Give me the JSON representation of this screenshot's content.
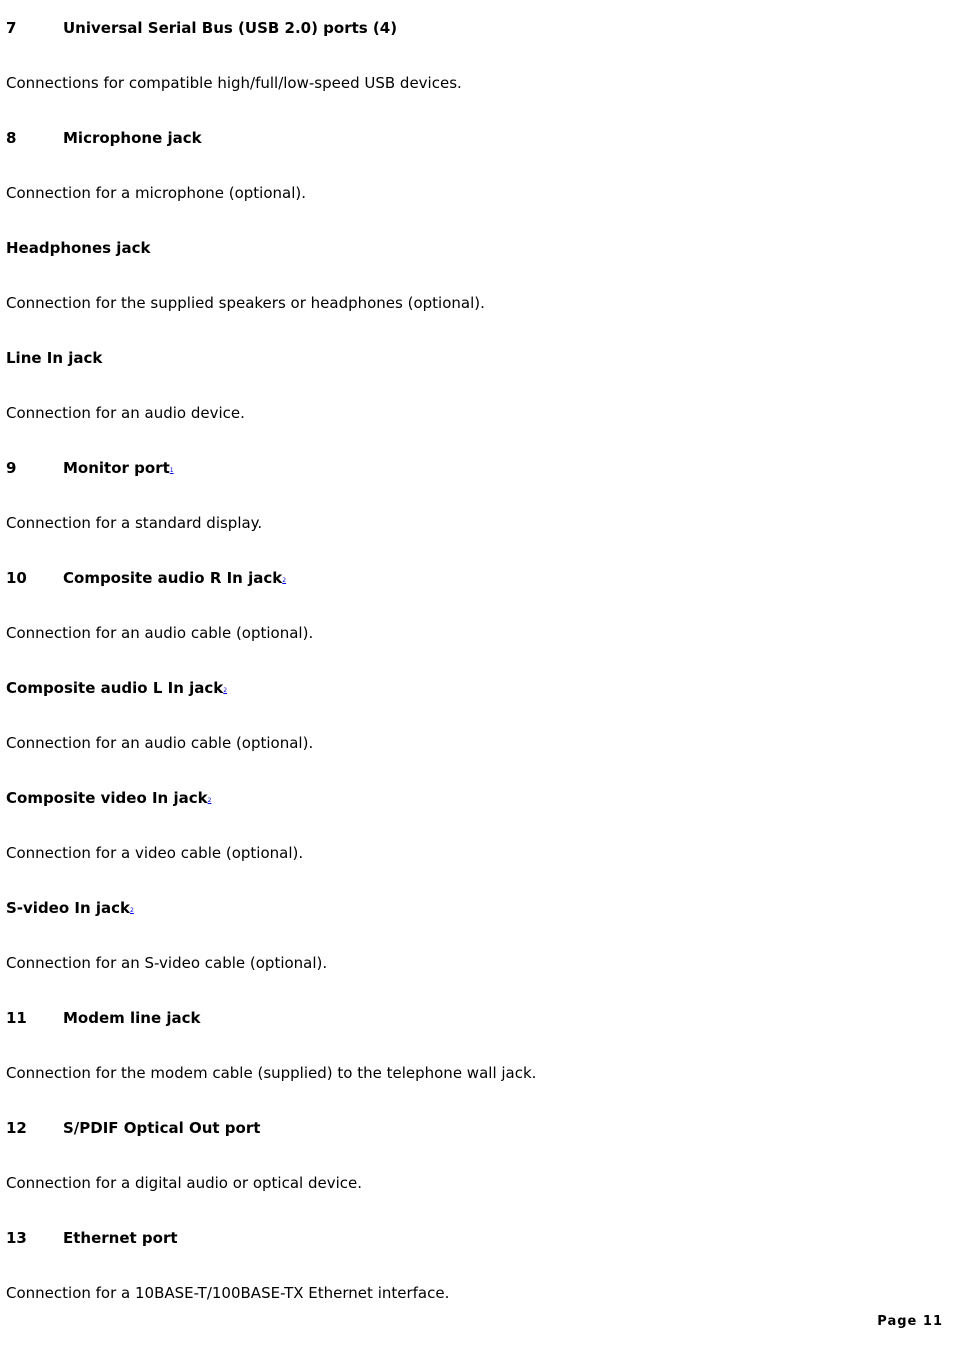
{
  "entries": [
    {
      "num": "7",
      "title": "Universal Serial Bus (USB 2.0) ports (4)",
      "footnote": "",
      "desc": "Connections for compatible high/full/low-speed USB devices."
    },
    {
      "num": "8",
      "title": "Microphone jack",
      "footnote": "",
      "desc": "Connection for a microphone (optional)."
    },
    {
      "num": "",
      "title": "Headphones jack",
      "footnote": "",
      "desc": "Connection for the supplied speakers or headphones (optional)."
    },
    {
      "num": "",
      "title": "Line In jack",
      "footnote": "",
      "desc": "Connection for an audio device."
    },
    {
      "num": "9",
      "title": "Monitor port",
      "footnote": "1",
      "desc": "Connection for a standard display."
    },
    {
      "num": "10",
      "title": "Composite audio R In jack",
      "footnote": "2",
      "desc": "Connection for an audio cable (optional)."
    },
    {
      "num": "",
      "title": "Composite audio L In jack",
      "footnote": "2",
      "desc": "Connection for an audio cable (optional)."
    },
    {
      "num": "",
      "title": "Composite video In jack",
      "footnote": "2",
      "desc": "Connection for a video cable (optional)."
    },
    {
      "num": "",
      "title": "S-video In jack",
      "footnote": "2",
      "desc": "Connection for an S-video cable (optional)."
    },
    {
      "num": "11",
      "title": "Modem line jack",
      "footnote": "",
      "desc": "Connection for the modem cable (supplied) to the telephone wall jack."
    },
    {
      "num": "12",
      "title": "S/PDIF Optical Out port",
      "footnote": "",
      "desc": "Connection for a digital audio or optical device."
    },
    {
      "num": "13",
      "title": "Ethernet port",
      "footnote": "",
      "desc": "Connection for a 10BASE-T/100BASE-TX Ethernet interface."
    }
  ],
  "footer": {
    "page_label": "Page 11"
  },
  "colors": {
    "text": "#000000",
    "link": "#0000ee",
    "background": "#ffffff"
  }
}
